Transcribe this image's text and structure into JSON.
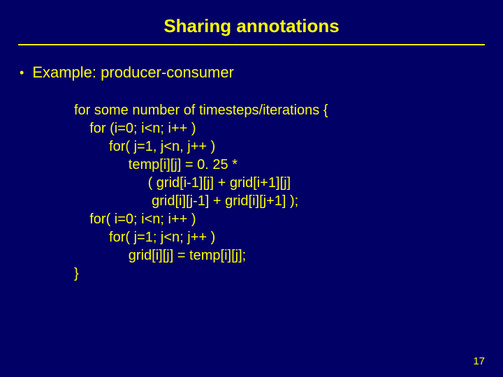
{
  "title": "Sharing annotations",
  "bullet": "Example: producer-consumer",
  "code": {
    "l1": "for some number of timesteps/iterations {",
    "l2": "    for (i=0; i<n; i++ )",
    "l3": "         for( j=1, j<n, j++ )",
    "l4": "              temp[i][j] = 0. 25 *",
    "l5": "                   ( grid[i-1][j] + grid[i+1][j]",
    "l6": "                    grid[i][j-1] + grid[i][j+1] );",
    "l7": "    for( i=0; i<n; i++ )",
    "l8": "         for( j=1; j<n; j++ )",
    "l9": "              grid[i][j] = temp[i][j];",
    "l10": "}"
  },
  "pageNumber": "17"
}
